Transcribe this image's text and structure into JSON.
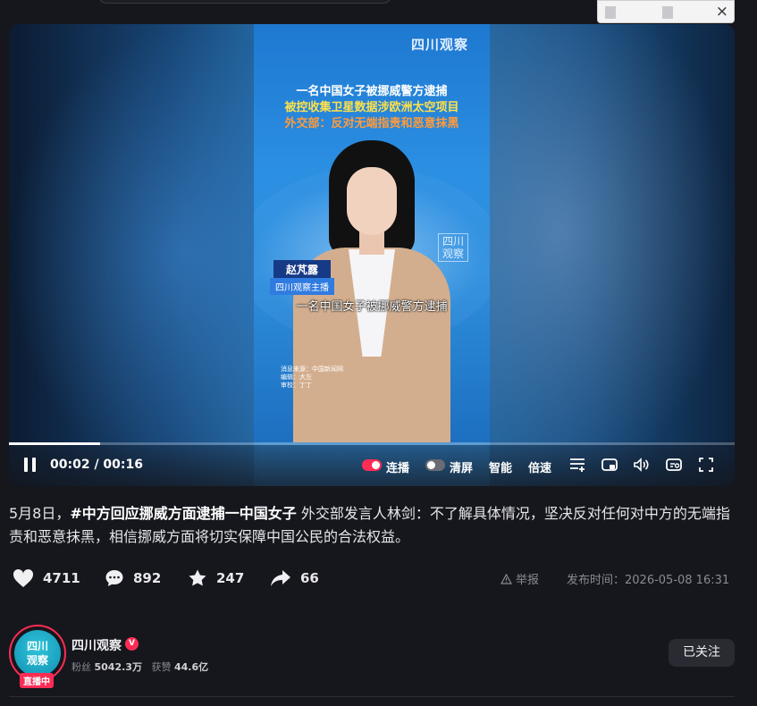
{
  "popup": {
    "close_label": "×"
  },
  "video": {
    "watermark": "四川观察",
    "headline1": "一名中国女子被挪威警方逮捕",
    "headline2": "被控收集卫星数据涉欧洲太空项目",
    "headline3": "外交部：反对无端指责和恶意抹黑",
    "stamp": "四川\n观察",
    "anchor_name": "赵芃露",
    "anchor_role": "四川观察主播",
    "subtitle": "一名中国女子被挪威警方逮捕",
    "credits": "消息来源：中国新闻网\n编辑：大左\n审校：丁丁",
    "progress_fraction": 0.125
  },
  "controls": {
    "time": "00:02 / 00:16",
    "autoplay_label": "连播",
    "clearscreen_label": "清屏",
    "smart_label": "智能",
    "speed_label": "倍速",
    "accent": "#fe2c55"
  },
  "description": {
    "prefix": "5月8日，",
    "hashtag": "#中方回应挪威方面逮捕一中国女子",
    "text": " 外交部发言人林剑：不了解具体情况，坚决反对任何对中方的无端指责和恶意抹黑，相信挪威方面将切实保障中国公民的合法权益。"
  },
  "actions": {
    "likes": "4711",
    "comments": "892",
    "favorites": "247",
    "shares": "66",
    "report_label": "举报",
    "publish_time": "发布时间：2026-05-08 16:31"
  },
  "author": {
    "avatar_text": "四川\n观察",
    "live_badge": "直播中",
    "name": "四川观察",
    "verified_mark": "V",
    "fans_label": "粉丝",
    "fans_value": "5042.3万",
    "likes_label": "获赞",
    "likes_value": "44.6亿",
    "follow_label": "已关注"
  }
}
